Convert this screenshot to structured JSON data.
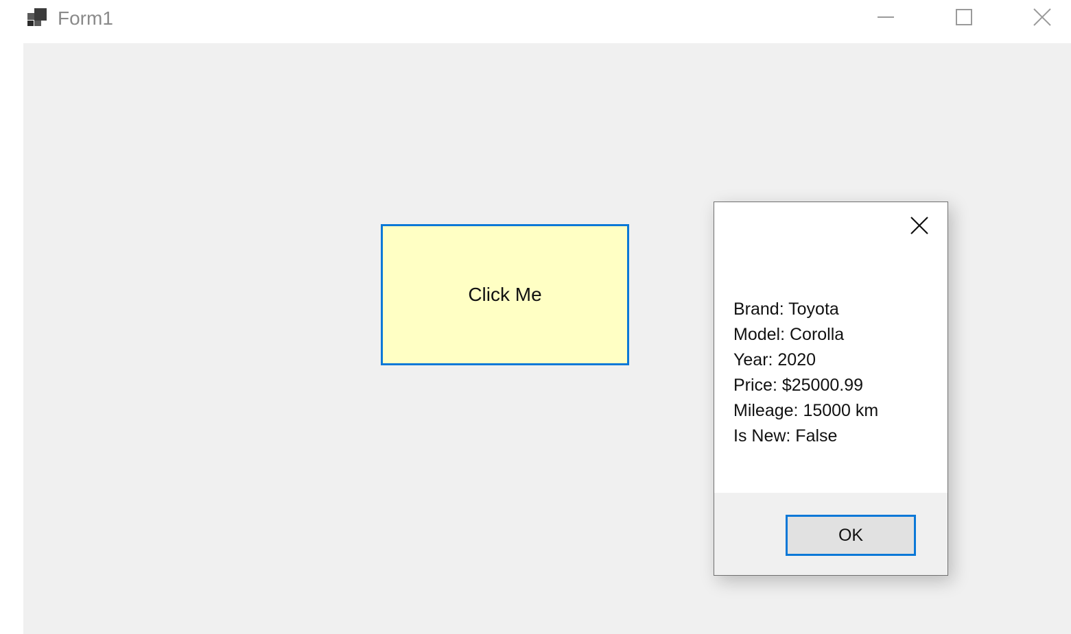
{
  "window": {
    "title": "Form1"
  },
  "icons": {
    "app": "form-app-icon",
    "minimize": "minimize-icon",
    "maximize": "maximize-icon",
    "close": "close-icon"
  },
  "form": {
    "button_label": "Click Me"
  },
  "message_box": {
    "lines": [
      "Brand: Toyota",
      "Model: Corolla",
      "Year: 2020",
      "Price: $25000.99",
      "Mileage: 15000 km",
      "Is New: False"
    ],
    "ok_label": "OK"
  },
  "colors": {
    "client_bg": "#f0f0f0",
    "button_bg": "#ffffc4",
    "focus_border": "#0a78d7",
    "ok_bg": "#e1e1e1"
  }
}
